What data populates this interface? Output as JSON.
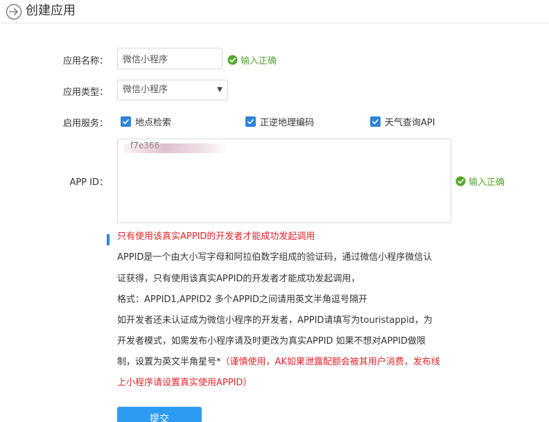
{
  "header": {
    "title": "创建应用"
  },
  "form": {
    "app_name": {
      "label": "应用名称：",
      "value": "微信小程序",
      "tip": "输入正确"
    },
    "app_type": {
      "label": "应用类型：",
      "selected": "微信小程序"
    },
    "services": {
      "label": "启用服务：",
      "items": [
        {
          "label": "地点检索",
          "checked": true
        },
        {
          "label": "正逆地理编码",
          "checked": true
        },
        {
          "label": "天气查询API",
          "checked": true
        }
      ]
    },
    "app_id": {
      "label": "APP ID：",
      "value": "f7e366",
      "tip": "输入正确"
    }
  },
  "notice": {
    "headline": "只有使用该真实APPID的开发者才能成功发起调用",
    "lines": [
      "APPID是一个由大小写字母和阿拉伯数字组成的验证码，通过微信小程序微信认",
      "证获得，只有使用该真实APPID的开发者才能成功发起调用，",
      "格式：APPID1,APPID2 多个APPID之间请用英文半角逗号隔开",
      "如开发者还未认证成为微信小程序的开发者，APPID请填写为touristappid，为",
      "开发者模式，如需发布小程序请及时更改为真实APPID 如果不想对APPID做限"
    ],
    "line6_normal": "制，设置为英文半角星号*",
    "line6_red": "（谨慎使用，AK如果泄露配额会被其用户消费，发布线",
    "line7_red": "上小程序请设置真实使用APPID）"
  },
  "actions": {
    "submit_label": "提交"
  },
  "colors": {
    "accent": "#2d84d8",
    "success": "#55a72e",
    "warning": "#e5252a",
    "button": "#2d9cf0"
  }
}
